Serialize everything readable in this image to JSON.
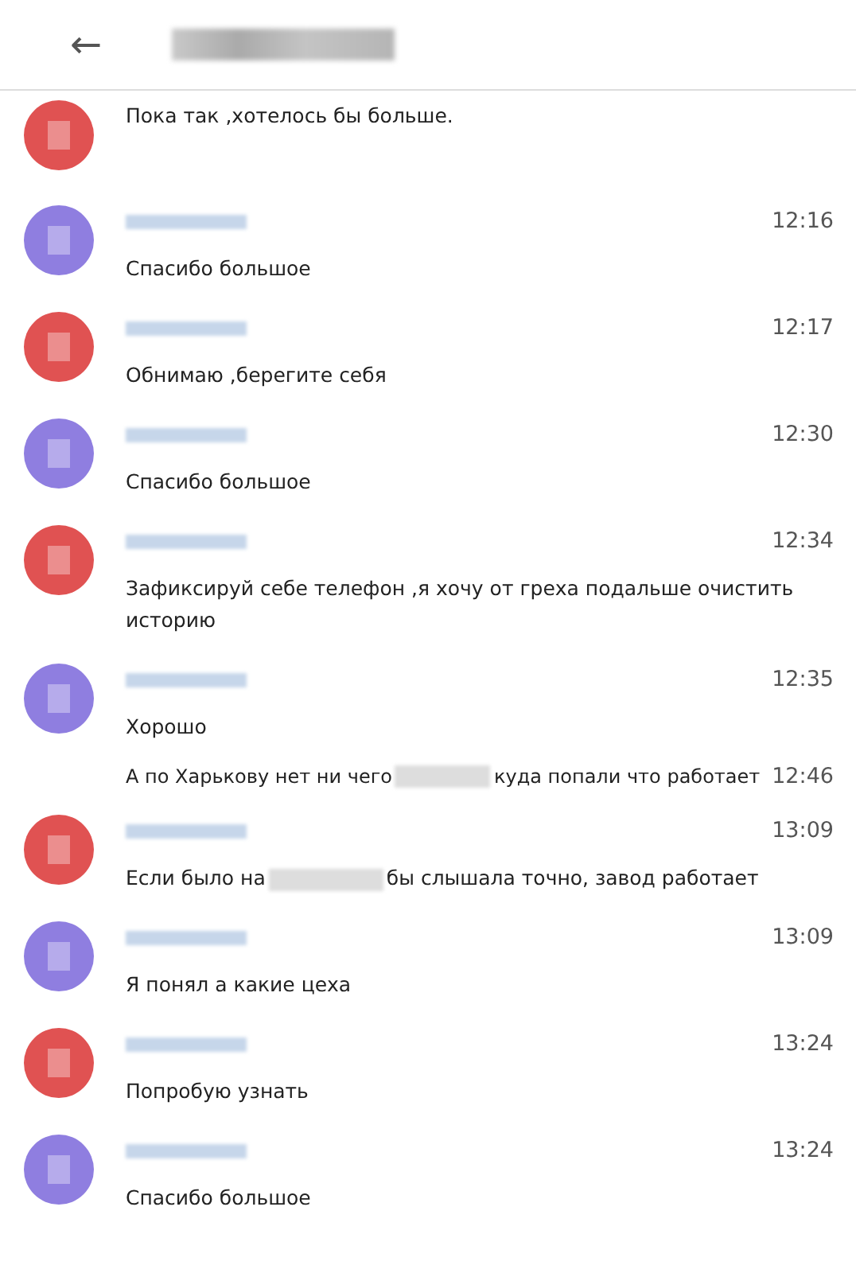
{
  "header": {
    "back": "←"
  },
  "messages": [
    {
      "kind": "cut",
      "color": "#e05252",
      "text": "Пока так ,хотелось бы больше."
    },
    {
      "kind": "full",
      "color": "#8f7ee0",
      "time": "12:16",
      "text": "Спасибо большое"
    },
    {
      "kind": "full",
      "color": "#e05252",
      "time": "12:17",
      "text": "Обнимаю ,берегите себя"
    },
    {
      "kind": "full",
      "color": "#8f7ee0",
      "time": "12:30",
      "text": "Спасибо большое"
    },
    {
      "kind": "full",
      "color": "#e05252",
      "time": "12:34",
      "text": "Зафиксируй себе телефон ,я хочу от греха подальше очистить историю"
    },
    {
      "kind": "full",
      "color": "#8f7ee0",
      "time": "12:35",
      "text": "Хорошо"
    },
    {
      "kind": "continuation",
      "time": "12:46",
      "text": "А по Харькову нет ни чего",
      "text_after": "куда попали что работает"
    },
    {
      "kind": "full",
      "color": "#e05252",
      "time": "13:09",
      "text": "Если было на",
      "text_after": "бы слышала точно, завод работает"
    },
    {
      "kind": "full",
      "color": "#8f7ee0",
      "time": "13:09",
      "text": "Я понял а какие цеха"
    },
    {
      "kind": "full",
      "color": "#e05252",
      "time": "13:24",
      "text": "Попробую узнать"
    },
    {
      "kind": "full",
      "color": "#8f7ee0",
      "time": "13:24",
      "text": "Спасибо большое"
    }
  ]
}
